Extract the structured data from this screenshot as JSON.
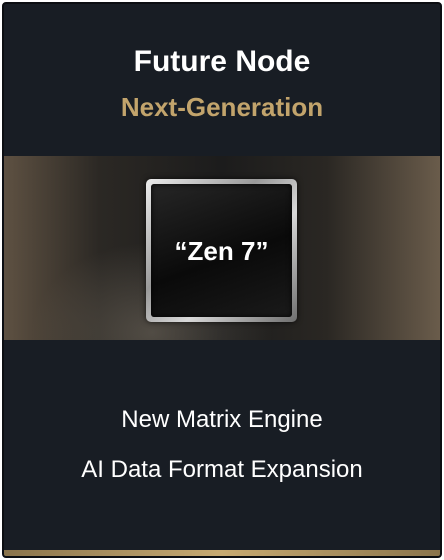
{
  "card": {
    "title": "Future Node",
    "subtitle": "Next-Generation",
    "chip_label": "“Zen 7”",
    "features": [
      "New Matrix Engine",
      "AI Data Format Expansion"
    ]
  },
  "colors": {
    "card_background": "#181d24",
    "subtitle_gold": "#c2a46c",
    "accent_bar": "#c7aa72",
    "text": "#ffffff"
  },
  "icons": {
    "chip": "processor-chip-icon"
  }
}
